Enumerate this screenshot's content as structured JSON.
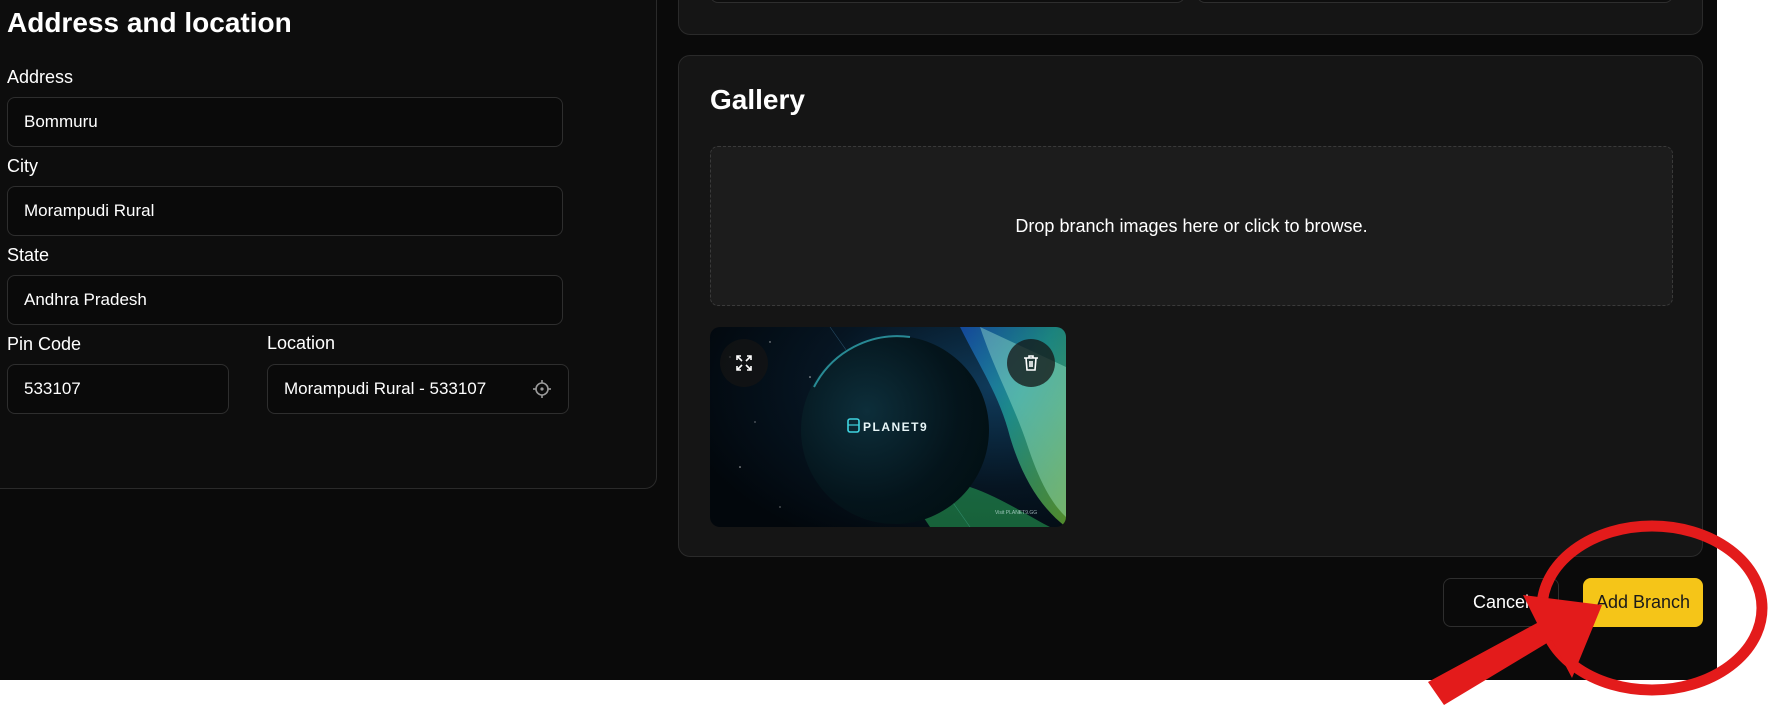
{
  "address_section": {
    "title": "Address and location",
    "address": {
      "label": "Address",
      "value": "Bommuru"
    },
    "city": {
      "label": "City",
      "value": "Morampudi Rural"
    },
    "state": {
      "label": "State",
      "value": "Andhra Pradesh"
    },
    "pin_code": {
      "label": "Pin Code",
      "value": "533107"
    },
    "location": {
      "label": "Location",
      "value": "Morampudi Rural - 533107",
      "icon": "crosshair-icon"
    }
  },
  "gallery": {
    "title": "Gallery",
    "dropzone_text": "Drop branch images here or click to browse.",
    "image": {
      "brand_text": "PLANET9",
      "caption_text": "Visit PLANET9.GG",
      "expand_icon": "expand-icon",
      "delete_icon": "trash-icon"
    }
  },
  "footer": {
    "cancel_label": "Cancel",
    "add_label": "Add Branch"
  },
  "colors": {
    "background": "#0a0a0a",
    "card": "#151515",
    "accent": "#f5c518",
    "annotation": "#e31b1b"
  }
}
